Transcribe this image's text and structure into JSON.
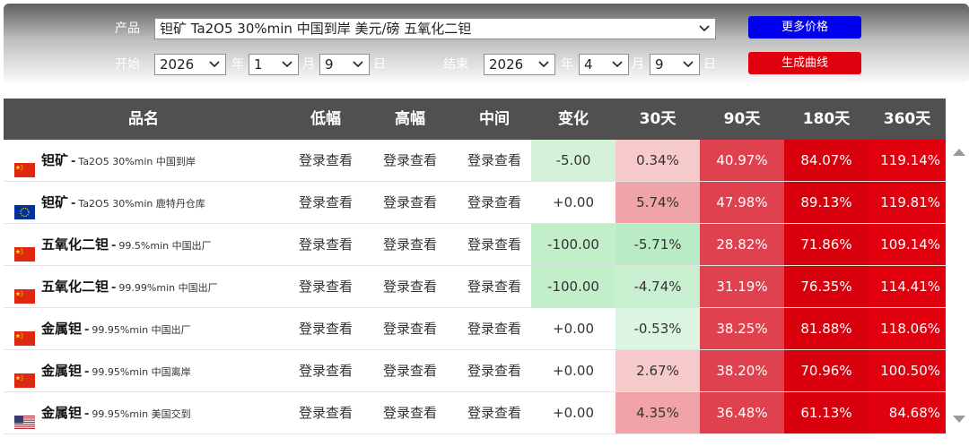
{
  "filters": {
    "product_label": "产品",
    "product_value": "钽矿 Ta2O5 30%min 中国到岸 美元/磅 五氧化二钽",
    "start_label": "开始",
    "end_label": "结束",
    "year_unit": "年",
    "month_unit": "月",
    "day_unit": "日",
    "start": {
      "year": "2026",
      "month": "1",
      "day": "9"
    },
    "end": {
      "year": "2026",
      "month": "4",
      "day": "9"
    },
    "more_prices_button": "更多价格",
    "generate_curve_button": "生成曲线"
  },
  "table": {
    "headers": [
      "品名",
      "低幅",
      "高幅",
      "中间",
      "变化",
      "30天",
      "90天",
      "180天",
      "360天"
    ],
    "rows": [
      {
        "flag": "cn",
        "name": "钽矿",
        "spec": "Ta2O5 30%min 中国到岸",
        "low": "登录查看",
        "high": "登录查看",
        "mid": "登录查看",
        "change": "-5.00",
        "d30": "0.34%",
        "d90": "40.97%",
        "d180": "84.07%",
        "d360": "119.14%"
      },
      {
        "flag": "eu",
        "name": "钽矿",
        "spec": "Ta2O5 30%min 鹿特丹仓库",
        "low": "登录查看",
        "high": "登录查看",
        "mid": "登录查看",
        "change": "+0.00",
        "d30": "5.74%",
        "d90": "47.98%",
        "d180": "89.13%",
        "d360": "119.81%"
      },
      {
        "flag": "cn",
        "name": "五氧化二钽",
        "spec": "99.5%min 中国出厂",
        "low": "登录查看",
        "high": "登录查看",
        "mid": "登录查看",
        "change": "-100.00",
        "d30": "-5.71%",
        "d90": "28.82%",
        "d180": "71.86%",
        "d360": "109.14%"
      },
      {
        "flag": "cn",
        "name": "五氧化二钽",
        "spec": "99.99%min 中国出厂",
        "low": "登录查看",
        "high": "登录查看",
        "mid": "登录查看",
        "change": "-100.00",
        "d30": "-4.74%",
        "d90": "31.19%",
        "d180": "76.35%",
        "d360": "114.41%"
      },
      {
        "flag": "cn",
        "name": "金属钽",
        "spec": "99.95%min 中国出厂",
        "low": "登录查看",
        "high": "登录查看",
        "mid": "登录查看",
        "change": "+0.00",
        "d30": "-0.53%",
        "d90": "38.25%",
        "d180": "81.88%",
        "d360": "118.06%"
      },
      {
        "flag": "cn",
        "name": "金属钽",
        "spec": "99.95%min 中国离岸",
        "low": "登录查看",
        "high": "登录查看",
        "mid": "登录查看",
        "change": "+0.00",
        "d30": "2.67%",
        "d90": "38.20%",
        "d180": "70.96%",
        "d360": "100.50%"
      },
      {
        "flag": "us",
        "name": "金属钽",
        "spec": "99.95%min 美国交到",
        "low": "登录查看",
        "high": "登录查看",
        "mid": "登录查看",
        "change": "+0.00",
        "d30": "4.35%",
        "d90": "36.48%",
        "d180": "61.13%",
        "d360": "84.68%"
      }
    ]
  },
  "colors": {
    "change_down": "#d4f2d8",
    "change_down_strong": "#c2eec9",
    "change_flat": "#ffffff",
    "pct_neg_strong": "#b9ecc4",
    "pct_neg": "#c8f0d0",
    "pct_neg_light": "#dcf5e1",
    "pct_low": "#f6c9cb",
    "pct_mid": "#f0a3a8",
    "d90": "#e0414f",
    "d180": "#d9000e",
    "d360": "#e1000e",
    "header_bg": "#505050",
    "button_blue": "#0000ee",
    "button_red": "#e1000e"
  }
}
